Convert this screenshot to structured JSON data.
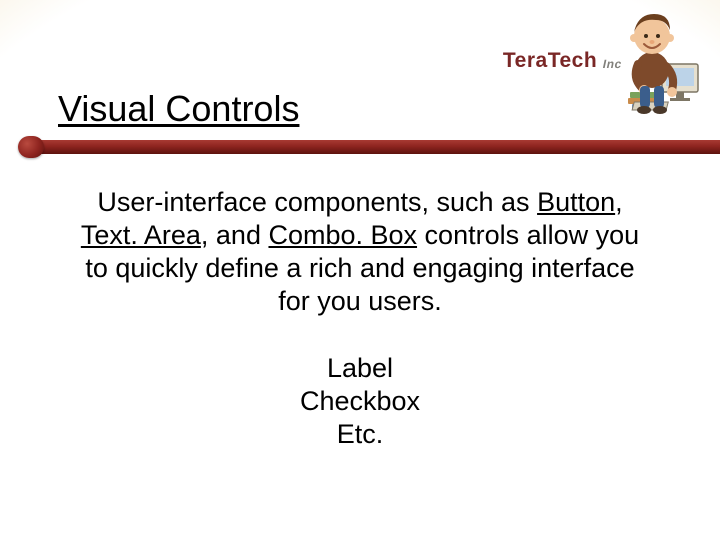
{
  "logo": {
    "brand": "TeraTech",
    "suffix": "Inc"
  },
  "slide": {
    "title": "Visual Controls",
    "para": {
      "s1": "User-interface components, such as ",
      "link1": "Button",
      "sep1": ", ",
      "link2": "Text. Area",
      "sep2": ", and ",
      "link3": "Combo. Box",
      "s2": " controls allow you to quickly define a rich and engaging interface for you users."
    },
    "list": {
      "i1": "Label",
      "i2": "Checkbox",
      "i3": "Etc."
    }
  }
}
